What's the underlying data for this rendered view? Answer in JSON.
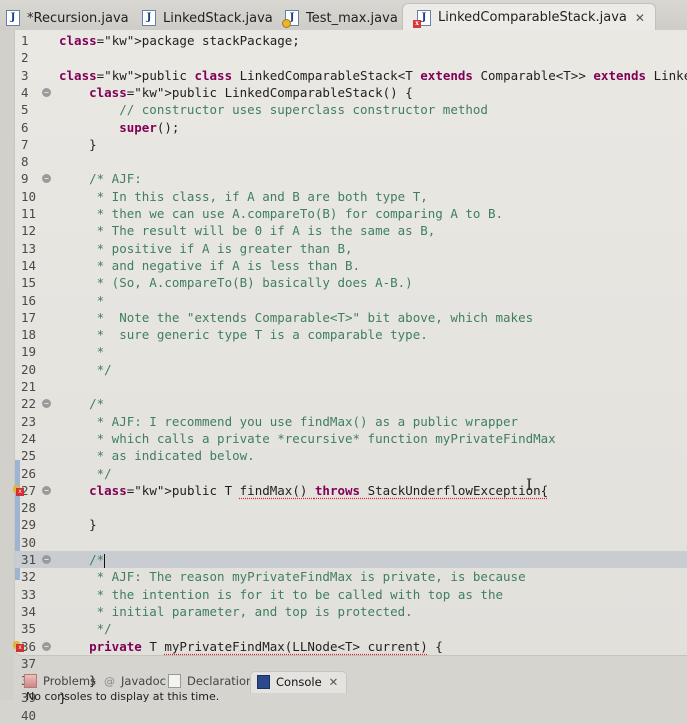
{
  "editor_tabs": [
    {
      "label": "*Recursion.java",
      "icon": "java-file-icon",
      "dirty": true,
      "active": false
    },
    {
      "label": "LinkedStack.java",
      "icon": "java-file-icon",
      "active": false
    },
    {
      "label": "Test_max.java",
      "icon": "java-file-warning-icon",
      "active": false
    },
    {
      "label": "LinkedComparableStack.java",
      "icon": "java-file-error-icon",
      "active": true,
      "close_icon": "close-icon"
    }
  ],
  "code_lines": [
    {
      "n": "1",
      "text": "package stackPackage;"
    },
    {
      "n": "2",
      "text": ""
    },
    {
      "n": "3",
      "text": "public class LinkedComparableStack<T extends Comparable<T>> extends LinkedStack<T> {"
    },
    {
      "n": "4",
      "text": "    public LinkedComparableStack() {",
      "fold": true
    },
    {
      "n": "5",
      "text": "        // constructor uses superclass constructor method"
    },
    {
      "n": "6",
      "text": "        super();"
    },
    {
      "n": "7",
      "text": "    }"
    },
    {
      "n": "8",
      "text": ""
    },
    {
      "n": "9",
      "text": "    /* AJF:",
      "fold": true
    },
    {
      "n": "10",
      "text": "     * In this class, if A and B are both type T,"
    },
    {
      "n": "11",
      "text": "     * then we can use A.compareTo(B) for comparing A to B."
    },
    {
      "n": "12",
      "text": "     * The result will be 0 if A is the same as B,"
    },
    {
      "n": "13",
      "text": "     * positive if A is greater than B,"
    },
    {
      "n": "14",
      "text": "     * and negative if A is less than B."
    },
    {
      "n": "15",
      "text": "     * (So, A.compareTo(B) basically does A-B.)"
    },
    {
      "n": "16",
      "text": "     *"
    },
    {
      "n": "17",
      "text": "     *  Note the \"extends Comparable<T>\" bit above, which makes"
    },
    {
      "n": "18",
      "text": "     *  sure generic type T is a comparable type."
    },
    {
      "n": "19",
      "text": "     *"
    },
    {
      "n": "20",
      "text": "     */"
    },
    {
      "n": "21",
      "text": ""
    },
    {
      "n": "22",
      "text": "    /*",
      "fold": true
    },
    {
      "n": "23",
      "text": "     * AJF: I recommend you use findMax() as a public wrapper"
    },
    {
      "n": "24",
      "text": "     * which calls a private *recursive* function myPrivateFindMax"
    },
    {
      "n": "25",
      "text": "     * as indicated below."
    },
    {
      "n": "26",
      "text": "     */"
    },
    {
      "n": "27",
      "text": "    public T findMax() throws StackUnderflowException{",
      "fold": true,
      "error": true
    },
    {
      "n": "28",
      "text": ""
    },
    {
      "n": "29",
      "text": "    }"
    },
    {
      "n": "30",
      "text": ""
    },
    {
      "n": "31",
      "text": "    /*",
      "fold": true,
      "current": true
    },
    {
      "n": "32",
      "text": "     * AJF: The reason myPrivateFindMax is private, is because"
    },
    {
      "n": "33",
      "text": "     * the intention is for it to be called with top as the"
    },
    {
      "n": "34",
      "text": "     * initial parameter, and top is protected."
    },
    {
      "n": "35",
      "text": "     */"
    },
    {
      "n": "36",
      "text": "    private T myPrivateFindMax(LLNode<T> current) {",
      "fold": true,
      "error": true
    },
    {
      "n": "37",
      "text": ""
    },
    {
      "n": "38",
      "text": "    }"
    },
    {
      "n": "39",
      "text": "}"
    },
    {
      "n": "40",
      "text": ""
    }
  ],
  "bottom_tabs": [
    {
      "label": "Problems",
      "icon": "problems-icon"
    },
    {
      "label": "Javadoc",
      "icon": "at-sign-icon"
    },
    {
      "label": "Declaration",
      "icon": "declaration-icon"
    },
    {
      "label": "Console",
      "icon": "console-icon",
      "active": true,
      "close_icon": "close-icon"
    }
  ],
  "console_message": "No consoles to display at this time.",
  "colors": {
    "keyword": "#7f0055",
    "comment": "#3f7f5f",
    "error": "#d23"
  }
}
